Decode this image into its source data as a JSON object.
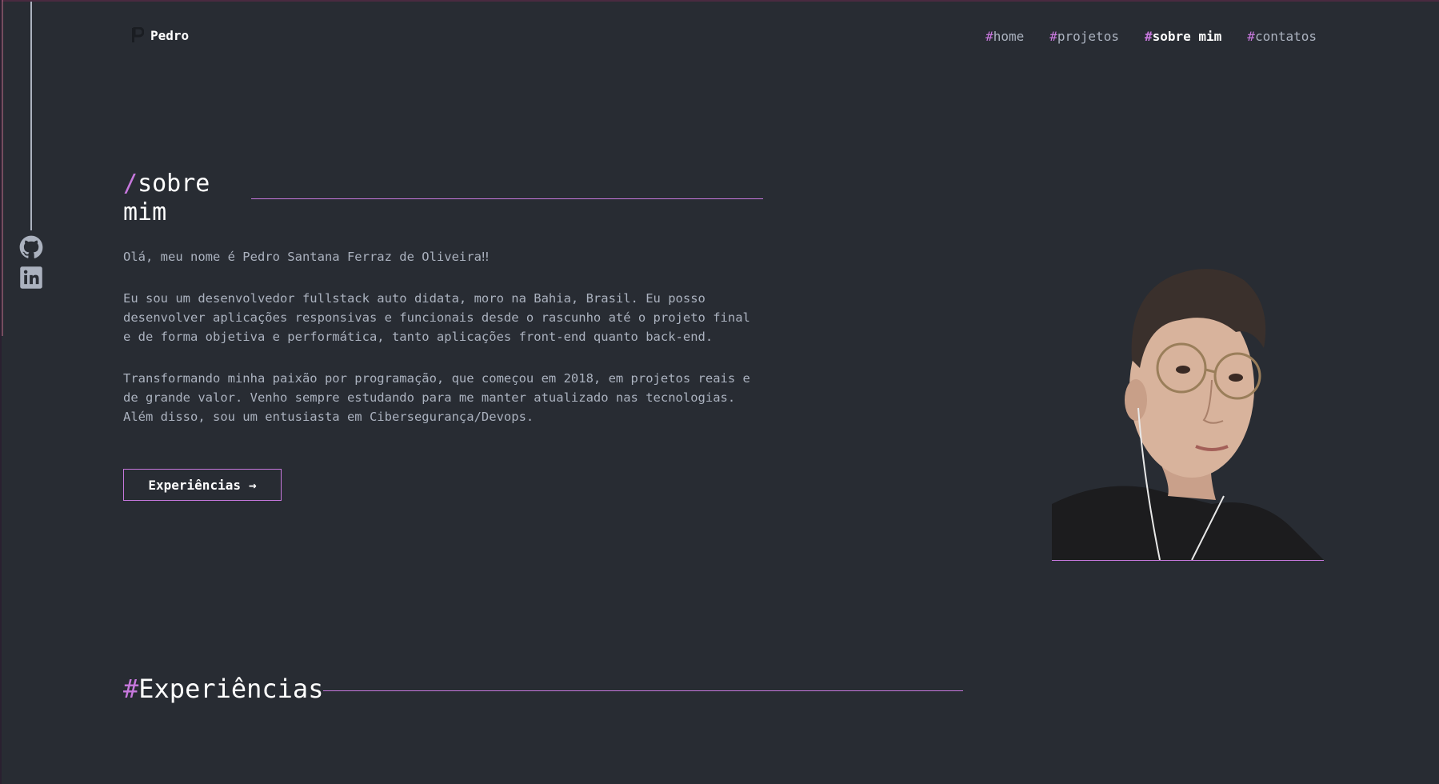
{
  "header": {
    "logo_text": "Pedro",
    "nav": [
      {
        "hash": "#",
        "label": "home"
      },
      {
        "hash": "#",
        "label": "projetos"
      },
      {
        "hash": "#",
        "label": "sobre mim"
      },
      {
        "hash": "#",
        "label": "contatos"
      }
    ]
  },
  "sidebar": {
    "icons": [
      "github-icon",
      "linkedin-icon"
    ]
  },
  "about": {
    "title_slash": "/",
    "title": "sobre mim",
    "paragraphs": [
      "Olá, meu nome é Pedro Santana Ferraz de Oliveira‼",
      "Eu sou um desenvolvedor fullstack auto didata, moro na Bahia, Brasil. Eu posso desenvolver aplicações responsivas e funcionais desde o rascunho até o projeto final e de forma objetiva e performática, tanto aplicações front-end quanto back-end.",
      "Transformando minha paixão por programação, que começou em 2018, em projetos reais e de grande valor. Venho sempre estudando para me manter atualizado nas tecnologias. Além disso, sou um entusiasta em Cibersegurança/Devops."
    ],
    "button_label": "Experiências",
    "button_arrow": "→"
  },
  "experiences": {
    "hash": "#",
    "title": "Experiências"
  },
  "colors": {
    "accent": "#c778dd",
    "background": "#282c33",
    "text": "#abb2bf",
    "white": "#ffffff"
  }
}
